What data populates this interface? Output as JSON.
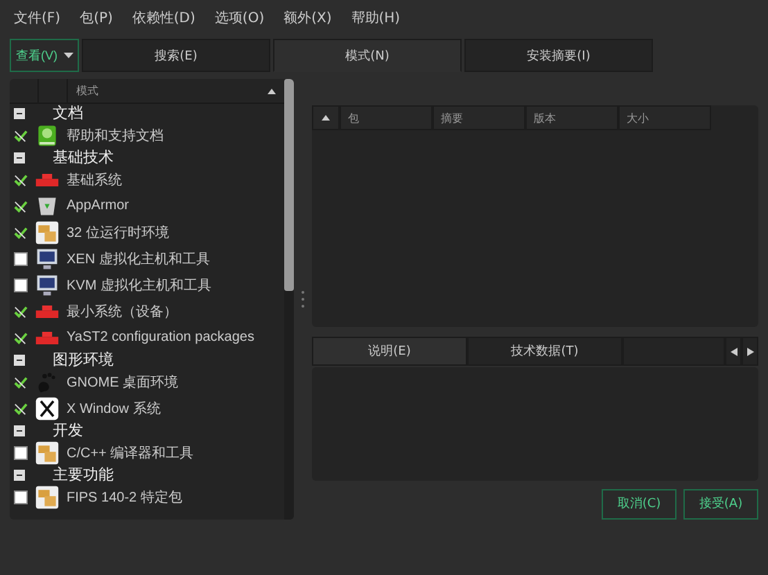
{
  "menu": [
    "文件(F)",
    "包(P)",
    "依赖性(D)",
    "选项(O)",
    "额外(X)",
    "帮助(H)"
  ],
  "view_button": {
    "label": "查看(V)"
  },
  "tabs": [
    {
      "label": "搜索(E)",
      "selected": false
    },
    {
      "label": "模式(N)",
      "selected": true
    },
    {
      "label": "安装摘要(I)",
      "selected": false
    }
  ],
  "pattern_tree": {
    "column": "模式",
    "groups": [
      {
        "title": "文档",
        "expanded": true,
        "items": [
          {
            "label": "帮助和支持文档",
            "installed": true,
            "kind": "book"
          }
        ]
      },
      {
        "title": "基础技术",
        "expanded": true,
        "items": [
          {
            "label": "基础系统",
            "installed": true,
            "kind": "bricks"
          },
          {
            "label": "AppArmor",
            "installed": true,
            "kind": "shield"
          },
          {
            "label": "32 位运行时环境",
            "installed": true,
            "kind": "boxes"
          },
          {
            "label": "XEN 虚拟化主机和工具",
            "installed": false,
            "kind": "monitor"
          },
          {
            "label": "KVM 虚拟化主机和工具",
            "installed": false,
            "kind": "monitor"
          },
          {
            "label": "最小系统（设备）",
            "installed": true,
            "kind": "bricks"
          },
          {
            "label": "YaST2 configuration packages",
            "installed": true,
            "kind": "bricks"
          }
        ]
      },
      {
        "title": "图形环境",
        "expanded": true,
        "items": [
          {
            "label": "GNOME 桌面环境",
            "installed": true,
            "kind": "foot"
          },
          {
            "label": "X Window 系统",
            "installed": true,
            "kind": "x"
          }
        ]
      },
      {
        "title": "开发",
        "expanded": true,
        "items": [
          {
            "label": "C/C++ 编译器和工具",
            "installed": false,
            "kind": "boxes"
          }
        ]
      },
      {
        "title": "主要功能",
        "expanded": true,
        "items": [
          {
            "label": "FIPS 140-2 特定包",
            "installed": false,
            "kind": "boxes"
          }
        ]
      }
    ]
  },
  "package_table": {
    "columns": [
      "包",
      "摘要",
      "版本",
      "大小"
    ]
  },
  "detail_tabs": [
    {
      "label": "说明(E)",
      "selected": true
    },
    {
      "label": "技术数据(T)",
      "selected": false
    }
  ],
  "buttons": [
    "取消(C)",
    "接受(A)"
  ]
}
